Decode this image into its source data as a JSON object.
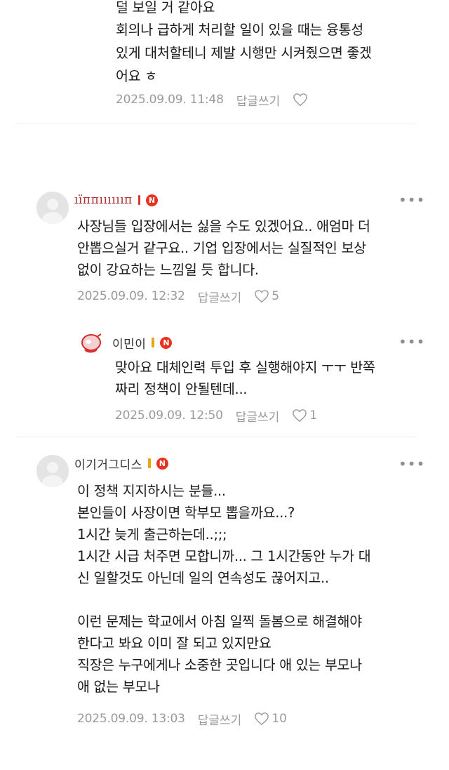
{
  "comments": [
    {
      "text": "덜 보일 거 같아요\n회의나 급하게 처리할 일이 있을 때는 융통성 있게 대처할테니 제발 시행만 시켜줬으면 좋겠어요 ㅎ",
      "lines": [
        "덜 보일 거 같아요",
        "회의나 급하게 처리할 일이 있을 때는 융통성",
        "있게 대처할테니 제발 시행만 시켜줬으면 좋겠",
        "어요 ㅎ"
      ],
      "date": "2025.09.09. 11:48",
      "reply_label": "답글쓰기",
      "likes": ""
    },
    {
      "username": "ıı̈ппııııııп",
      "lines": [
        "사장님들 입장에서는 싫을 수도 있겠어요.. 애엄마 더",
        "안뽑으실거 같구요.. 기업 입장에서는 실질적인 보상",
        "없이 강요하는 느낌일 듯 합니다."
      ],
      "date": "2025.09.09. 12:32",
      "reply_label": "답글쓰기",
      "likes": "5",
      "badge_color": "#e8321e",
      "badge_label": "N"
    },
    {
      "username": "이민이",
      "lines": [
        "맞아요 대체인력 투입 후 실행해야지 ㅜㅜ 반쪽",
        "짜리 정책이 안될텐데..."
      ],
      "date": "2025.09.09. 12:50",
      "reply_label": "답글쓰기",
      "likes": "1",
      "badge_label": "N"
    },
    {
      "username": "이기거그디스",
      "lines": [
        "이 정책 지지하시는 분들...",
        "본인들이 사장이면 학부모 뽑을까요...?",
        "1시간 늦게 출근하는데..;;;",
        "1시간 시급 처주면 모합니까... 그 1시간동안 누가 대",
        "신 일할것도 아닌데 일의 연속성도 끊어지고..",
        "",
        "이런 문제는 학교에서 아침 일찍 돌봄으로 해결해야",
        "한다고 봐요 이미 잘 되고 있지만요",
        "직장은 누구에게나 소중한 곳입니다 애 있는 부모나",
        "애 없는 부모나"
      ],
      "date": "2025.09.09. 13:03",
      "reply_label": "답글쓰기",
      "likes": "10",
      "badge_label": "N"
    }
  ],
  "more_label": "•••",
  "colors": {
    "meta_gray": "#9a9a9a",
    "naver_red": "#e8321e",
    "badge_gold": "#e8a317"
  }
}
